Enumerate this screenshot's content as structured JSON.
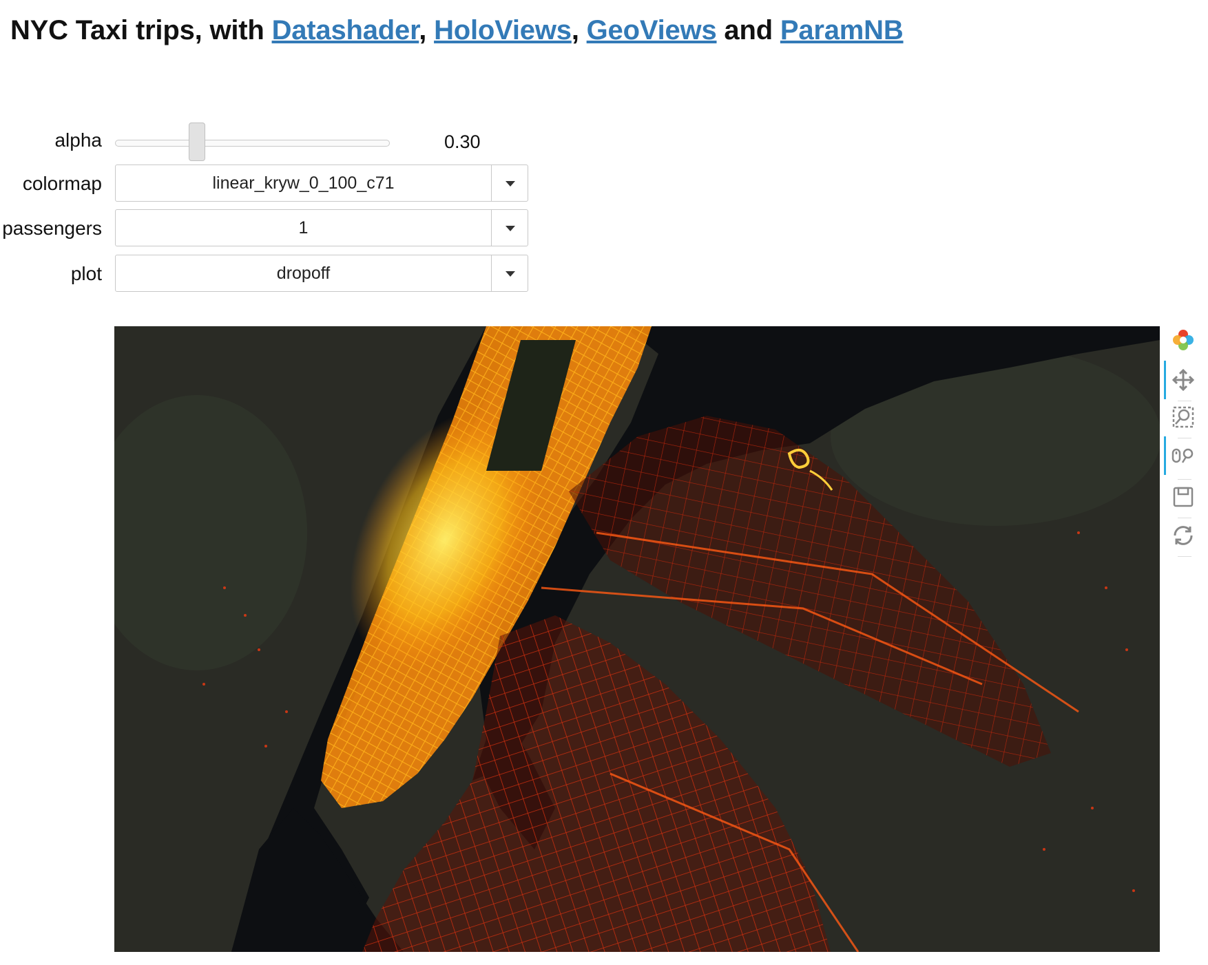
{
  "title": {
    "prefix": "NYC Taxi trips, with ",
    "links": [
      "Datashader",
      "HoloViews",
      "GeoViews",
      "ParamNB"
    ],
    "sep1": ", ",
    "sep2": ", ",
    "sep3": " and "
  },
  "controls": {
    "alpha": {
      "label": "alpha",
      "value": "0.30",
      "fraction": 0.3
    },
    "colormap": {
      "label": "colormap",
      "value": "linear_kryw_0_100_c71"
    },
    "passengers": {
      "label": "passengers",
      "value": "1"
    },
    "plot": {
      "label": "plot",
      "value": "dropoff"
    }
  },
  "toolbar": {
    "tools": [
      "bokeh-logo-icon",
      "pan-icon",
      "box-zoom-icon",
      "wheel-zoom-icon",
      "save-icon",
      "reset-icon"
    ]
  },
  "colors": {
    "link": "#337ab7",
    "map_background": "#1b1d18",
    "hot_yellow": "#ffd21a",
    "hot_orange": "#ff8a0a",
    "hot_red": "#e8290a",
    "water": "#0d0f12"
  }
}
